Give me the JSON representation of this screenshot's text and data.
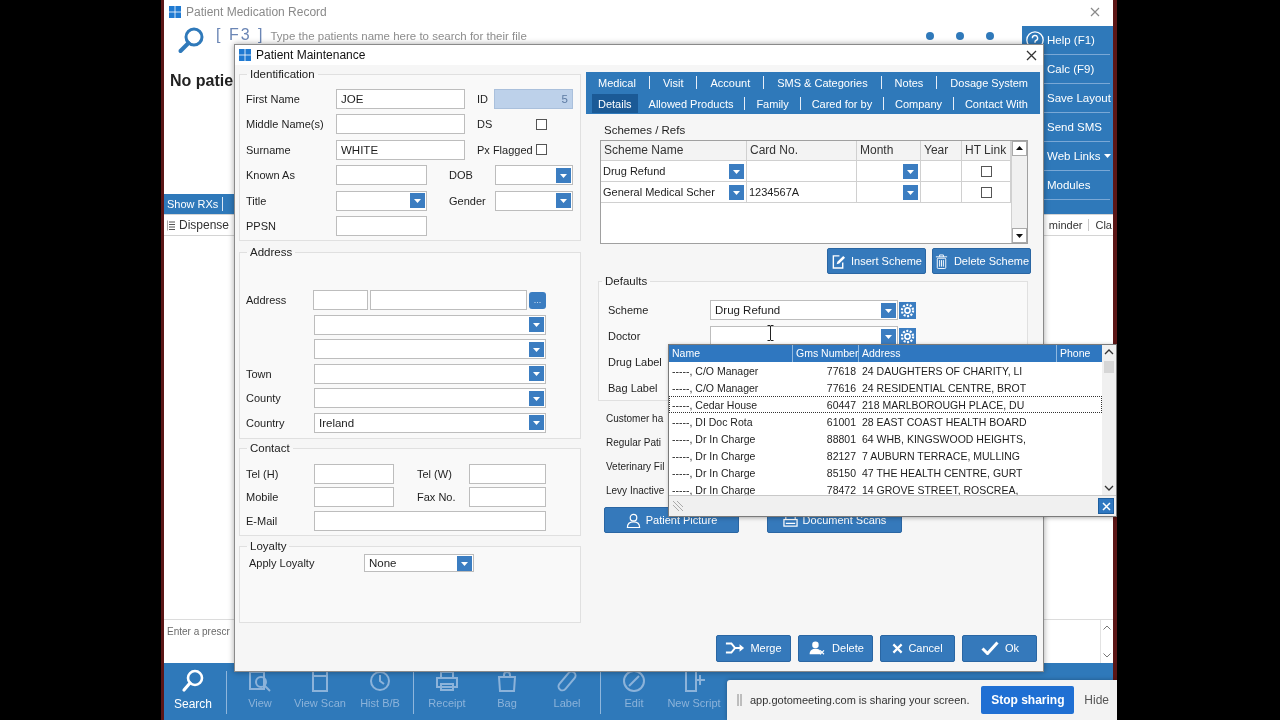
{
  "window": {
    "title": "Patient Medication Record"
  },
  "search": {
    "hotkey": "[ F3 ]",
    "placeholder": "Type the patients name here to search for their file"
  },
  "patient_banner": "No patie",
  "side_menu": [
    {
      "label": "Help (F1)",
      "kind": "help"
    },
    {
      "label": "Calc (F9)",
      "kind": "plain"
    },
    {
      "label": "Save Layout",
      "kind": "plain"
    },
    {
      "label": "Send SMS",
      "kind": "plain"
    },
    {
      "label": "Web Links",
      "kind": "menu"
    },
    {
      "label": "Modules",
      "kind": "plain"
    }
  ],
  "rx_tab": {
    "label": "Show RXs"
  },
  "table": {
    "columns": [
      "Dispense",
      "minder",
      "Cla"
    ]
  },
  "prescription": {
    "placeholder": "Enter a prescr"
  },
  "dialog": {
    "title": "Patient Maintenance",
    "identification": {
      "title": "Identification",
      "rows": [
        {
          "label": "First Name",
          "kind": "text",
          "value": "JOE",
          "side": {
            "label": "ID",
            "kind": "readonly",
            "value": "5"
          }
        },
        {
          "label": "Middle Name(s)",
          "kind": "text",
          "side": {
            "label": "DS",
            "kind": "checkbox",
            "checked": false
          }
        },
        {
          "label": "Surname",
          "kind": "text",
          "value": "WHITE",
          "side": {
            "label": "Px Flagged",
            "kind": "checkbox",
            "checked": false
          }
        },
        {
          "label": "Known As",
          "kind": "text",
          "side": {
            "label": "DOB",
            "kind": "dropdown"
          }
        },
        {
          "label": "Title",
          "kind": "dropdown",
          "side": {
            "label": "Gender",
            "kind": "dropdown"
          }
        },
        {
          "label": "PPSN",
          "kind": "text"
        }
      ]
    },
    "address": {
      "title": "Address",
      "rows": [
        {
          "label": "Address",
          "kind": "split",
          "button": "..."
        },
        {
          "kind": "dropdown"
        },
        {
          "kind": "dropdown"
        },
        {
          "label": "Town",
          "kind": "dropdown"
        },
        {
          "label": "County",
          "kind": "dropdown"
        },
        {
          "label": "Country",
          "kind": "dropdown",
          "value": "Ireland"
        }
      ]
    },
    "contact": {
      "title": "Contact",
      "rows": [
        {
          "label": "Tel (H)",
          "side_label": "Tel (W)"
        },
        {
          "label": "Mobile",
          "side_label": "Fax No."
        },
        {
          "label": "E-Mail"
        }
      ]
    },
    "loyalty": {
      "title": "Loyalty",
      "label": "Apply Loyalty",
      "value": "None"
    },
    "tab_rows": [
      {
        "tabs": [
          {
            "label": "Medical",
            "selected": false
          },
          {
            "label": "Visit",
            "selected": false
          },
          {
            "label": "Account",
            "selected": false
          },
          {
            "label": "SMS & Categories",
            "selected": false
          },
          {
            "label": "Notes",
            "selected": false
          },
          {
            "label": "Dosage System",
            "selected": false
          }
        ]
      },
      {
        "tabs": [
          {
            "label": "Details",
            "selected": true
          },
          {
            "label": "Allowed Products",
            "selected": false
          },
          {
            "label": "Family",
            "selected": false
          },
          {
            "label": "Cared for by",
            "selected": false
          },
          {
            "label": "Company",
            "selected": false
          },
          {
            "label": "Contact With",
            "selected": false
          }
        ]
      }
    ],
    "schemes": {
      "title": "Schemes / Refs",
      "columns": [
        "Scheme Name",
        "Card No.",
        "Month",
        "Year",
        "HT Link"
      ],
      "rows": [
        {
          "scheme_name": "Drug Refund",
          "ht_link": false
        },
        {
          "scheme_name": "General Medical Scher",
          "card_no": "1234567A",
          "ht_link": false
        }
      ]
    },
    "scheme_buttons": [
      {
        "label": "Insert Scheme",
        "kind": "insert"
      },
      {
        "label": "Delete Scheme",
        "kind": "delete"
      }
    ],
    "defaults": {
      "title": "Defaults",
      "fields": [
        {
          "label": "Scheme",
          "kind": "combo",
          "value": "Drug Refund"
        },
        {
          "label": "Doctor",
          "kind": "combo"
        },
        {
          "label": "Drug Label",
          "kind": "plain"
        },
        {
          "label": "Bag Label",
          "kind": "plain"
        }
      ]
    },
    "options": [
      "Customer ha",
      "Regular Pati",
      "Veterinary Fil",
      "Levy Inactive"
    ],
    "media_buttons": [
      {
        "label": "Patient Picture",
        "kind": "picture"
      },
      {
        "label": "Document Scans",
        "kind": "scans"
      }
    ],
    "doctor_lookup": {
      "columns": [
        "Name",
        "Gms Number",
        "Address",
        "Phone"
      ],
      "rows": [
        {
          "name": "-----, C/O Manager",
          "gms_number": "77618",
          "address": "24 DAUGHTERS OF CHARITY, LI",
          "selected": false
        },
        {
          "name": "-----, C/O Manager",
          "gms_number": "77616",
          "address": "24 RESIDENTIAL CENTRE, BROT",
          "selected": false
        },
        {
          "name": "-----, Cedar House",
          "gms_number": "60447",
          "address": "218 MARLBOROUGH PLACE, DU",
          "selected": true
        },
        {
          "name": "-----, DI Doc Rota",
          "gms_number": "61001",
          "address": "28 EAST COAST HEALTH BOARD",
          "selected": false
        },
        {
          "name": "-----, Dr In Charge",
          "gms_number": "88801",
          "address": "64 WHB, KINGSWOOD HEIGHTS,",
          "selected": false
        },
        {
          "name": "-----, Dr In Charge",
          "gms_number": "82127",
          "address": "7 AUBURN TERRACE, MULLING",
          "selected": false
        },
        {
          "name": "-----, Dr In Charge",
          "gms_number": "85150",
          "address": "47 THE HEALTH CENTRE, GURT",
          "selected": false
        },
        {
          "name": "-----, Dr In Charge",
          "gms_number": "78472",
          "address": "14 GROVE STREET, ROSCREA,",
          "selected": false
        }
      ]
    },
    "footer_buttons": [
      {
        "label": "Merge",
        "kind": "merge"
      },
      {
        "label": "Delete",
        "kind": "delete"
      },
      {
        "label": "Cancel",
        "kind": "cancel"
      },
      {
        "label": "Ok",
        "kind": "ok"
      }
    ]
  },
  "toolbar": [
    {
      "label": "Search",
      "kind": "search",
      "disabled": false
    },
    {
      "label": "View",
      "kind": "view",
      "disabled": true
    },
    {
      "label": "View Scan",
      "kind": "scan",
      "disabled": true
    },
    {
      "label": "Hist B/B",
      "kind": "history",
      "disabled": true
    },
    {
      "label": "Receipt",
      "kind": "receipt",
      "disabled": true
    },
    {
      "label": "Bag",
      "kind": "bag",
      "disabled": true
    },
    {
      "label": "Label",
      "kind": "label",
      "disabled": true
    },
    {
      "label": "Edit",
      "kind": "edit",
      "disabled": true
    },
    {
      "label": "New Script",
      "kind": "new",
      "disabled": true
    }
  ],
  "sharing_bar": {
    "message": "app.gotomeeting.com is sharing your screen.",
    "stop_button": "Stop sharing",
    "hide_link": "Hide"
  }
}
